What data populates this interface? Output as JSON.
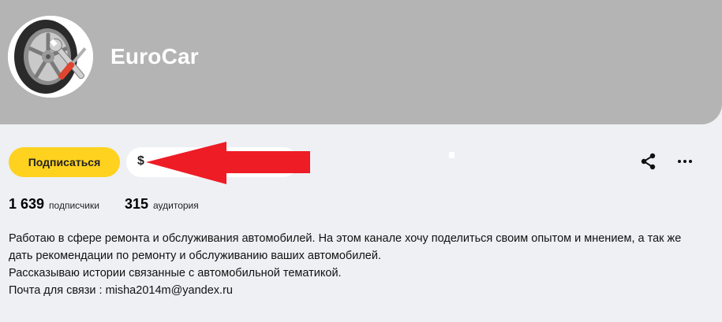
{
  "channel": {
    "name": "EuroCar",
    "avatar": "wheel-and-wrench-logo"
  },
  "actions": {
    "subscribe_label": "Подписаться",
    "second_icon": "$",
    "share_icon": "share-icon",
    "more_icon": "more-icon"
  },
  "stats": {
    "subscribers_value": "1 639",
    "subscribers_label": "подписчики",
    "audience_value": "315",
    "audience_label": "аудитория"
  },
  "description": {
    "line1": "Работаю в сфере ремонта и обслуживания автомобилей. На этом канале хочу поделиться своим опытом и мнением, а так же дать рекомендации по ремонту и обслуживанию ваших автомобилей.",
    "line2": "Рассказываю истории связанные с автомобильной тематикой.",
    "line3": "Почта для связи : misha2014m@yandex.ru"
  },
  "colors": {
    "cover": "#b4b4b4",
    "page": "#eef0f4",
    "subscribe": "#ffd21f",
    "arrow": "#ee1c25"
  }
}
